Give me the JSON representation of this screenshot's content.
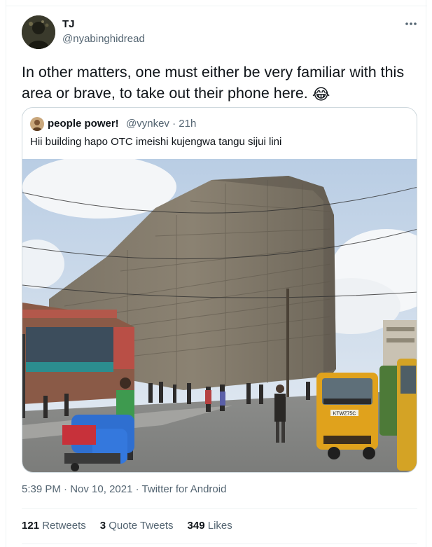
{
  "tweet": {
    "display_name": "TJ",
    "handle": "@nyabinghidread",
    "more_icon": "more-horizontal-icon",
    "text": "In other matters, one must either be very familiar with this area or brave, to take out their phone here.",
    "emoji": "😂"
  },
  "quoted_tweet": {
    "display_name": "people power!",
    "handle": "@vynkev",
    "separator": "·",
    "time_ago": "21h",
    "text": "Hii building hapo OTC imeishi kujengwa tangu sijui lini",
    "photo_description": "building covered in green construction netting",
    "tuktuk_plate": "KTWZ75C"
  },
  "meta": {
    "time": "5:39 PM",
    "separator": "·",
    "date": "Nov 10, 2021",
    "source": "Twitter for Android"
  },
  "stats": {
    "retweets_count": "121",
    "retweets_label": "Retweets",
    "quotes_count": "3",
    "quotes_label": "Quote Tweets",
    "likes_count": "349",
    "likes_label": "Likes"
  },
  "colors": {
    "secondary_text": "#536471",
    "border": "#cfd9de",
    "divider": "#eff3f4"
  }
}
